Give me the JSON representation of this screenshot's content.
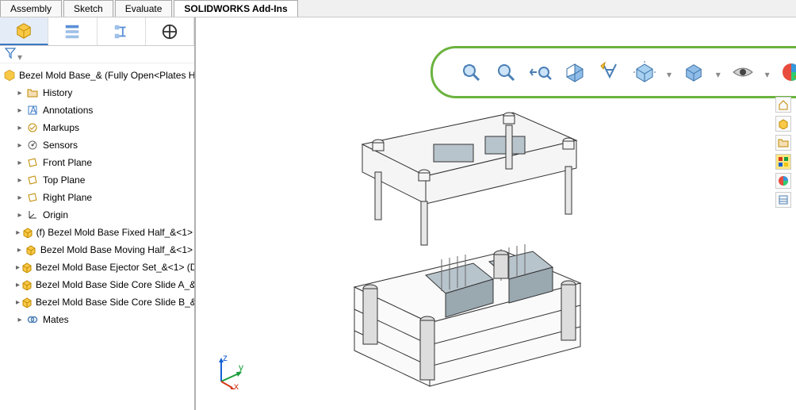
{
  "tabs": {
    "assembly": "Assembly",
    "sketch": "Sketch",
    "evaluate": "Evaluate",
    "addins": "SOLIDWORKS Add-Ins"
  },
  "hud": {
    "icons": [
      "zoom-fit",
      "zoom-area",
      "prev-view",
      "section-view",
      "dynamic-annotation",
      "view-orientation",
      "display-style",
      "hide-show",
      "edit-appearance",
      "apply-scene",
      "view-settings"
    ]
  },
  "tree": {
    "root": "Bezel Mold Base_&  (Fully Open<Plates H",
    "items": [
      {
        "label": "History",
        "icon": "history"
      },
      {
        "label": "Annotations",
        "icon": "annotation"
      },
      {
        "label": "Markups",
        "icon": "markup"
      },
      {
        "label": "Sensors",
        "icon": "sensor"
      },
      {
        "label": "Front Plane",
        "icon": "plane"
      },
      {
        "label": "Top Plane",
        "icon": "plane"
      },
      {
        "label": "Right Plane",
        "icon": "plane"
      },
      {
        "label": "Origin",
        "icon": "origin"
      },
      {
        "label": "(f) Bezel Mold Base Fixed Half_&<1>",
        "icon": "asm"
      },
      {
        "label": "Bezel Mold Base Moving Half_&<1>",
        "icon": "asm"
      },
      {
        "label": "Bezel Mold Base Ejector Set_&<1> (D",
        "icon": "asm"
      },
      {
        "label": "Bezel Mold Base Side Core Slide A_&",
        "icon": "asm"
      },
      {
        "label": "Bezel Mold Base Side Core Slide B_&",
        "icon": "asm"
      },
      {
        "label": "Mates",
        "icon": "mates"
      }
    ]
  },
  "triad": {
    "x": "x",
    "y": "y",
    "z": "z"
  }
}
